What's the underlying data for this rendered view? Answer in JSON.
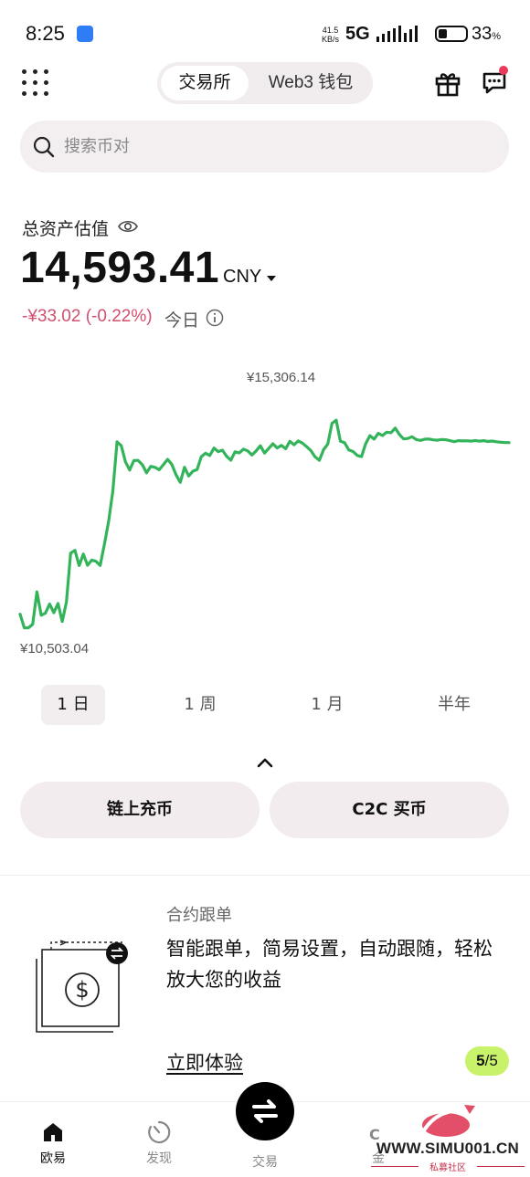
{
  "status_bar": {
    "time": "8:25",
    "speed_value": "41.5",
    "speed_unit": "KB/s",
    "network": "5G",
    "battery_level": 0.33,
    "battery_text": "33",
    "battery_unit": "%"
  },
  "header": {
    "tabs": [
      {
        "label": "交易所",
        "active": true
      },
      {
        "label": "Web3 钱包",
        "active": false
      }
    ]
  },
  "search": {
    "placeholder": "搜索币对"
  },
  "assets": {
    "label": "总资产估值",
    "value": "14,593.41",
    "currency": "CNY",
    "change": "-¥33.02 (-0.22%)",
    "change_period": "今日"
  },
  "chart_data": {
    "type": "line",
    "max_label": "¥15,306.14",
    "min_label": "¥10,503.04",
    "max": 15306.14,
    "min": 10503.04,
    "color": "#33b45a",
    "grid": false,
    "values": [
      10853,
      10582,
      10585,
      10654,
      11294,
      10831,
      10874,
      11053,
      10883,
      11064,
      10708,
      11094,
      12060,
      12115,
      11814,
      12041,
      11819,
      11923,
      11899,
      11816,
      12229,
      12691,
      13289,
      14260,
      14184,
      13866,
      13703,
      13890,
      13894,
      13807,
      13648,
      13776,
      13756,
      13709,
      13810,
      13914,
      13817,
      13610,
      13460,
      13759,
      13586,
      13681,
      13713,
      13969,
      14036,
      13990,
      14137,
      14067,
      14097,
      13976,
      13898,
      14063,
      14043,
      14116,
      14082,
      14000,
      14082,
      14183,
      14038,
      14130,
      14222,
      14139,
      14190,
      14125,
      14272,
      14203,
      14279,
      14236,
      14165,
      14087,
      13964,
      13896,
      14108,
      14218,
      14627,
      14688,
      14274,
      14244,
      14101,
      14069,
      13992,
      13969,
      14224,
      14384,
      14315,
      14428,
      14386,
      14452,
      14442,
      14533,
      14405,
      14319,
      14328,
      14361,
      14306,
      14289,
      14313,
      14317,
      14300,
      14293,
      14307,
      14302,
      14285,
      14265,
      14285,
      14279,
      14283,
      14276,
      14286,
      14275,
      14285,
      14267,
      14277,
      14263,
      14253,
      14246,
      14247
    ]
  },
  "periods": [
    {
      "label": "1 日",
      "active": true
    },
    {
      "label": "1 周",
      "active": false
    },
    {
      "label": "1 月",
      "active": false
    },
    {
      "label": "半年",
      "active": false
    }
  ],
  "actions": {
    "deposit": "链上充币",
    "buy": "C2C 买币"
  },
  "promo": {
    "title": "合约跟单",
    "description": "智能跟单，简易设置，自动跟随，轻松放大您的收益",
    "cta": "立即体验",
    "page_current": "5",
    "page_total": "/5"
  },
  "bottom_nav": [
    {
      "label": "欧易",
      "icon": "home-icon",
      "active": true
    },
    {
      "label": "发现",
      "icon": "discover-icon",
      "active": false
    },
    {
      "label": "交易",
      "icon": "swap-icon",
      "active": false
    },
    {
      "label": "金",
      "icon": "finance-icon",
      "active": false
    }
  ],
  "watermark": {
    "url": "WWW.SIMU001.CN",
    "subtitle": "私募社区"
  },
  "colors": {
    "accent_green": "#33b45a",
    "negative": "#d24f6e",
    "pill_bg": "#f2ecee",
    "badge": "#c8f26a",
    "notify_dot": "#ea3a5a"
  }
}
